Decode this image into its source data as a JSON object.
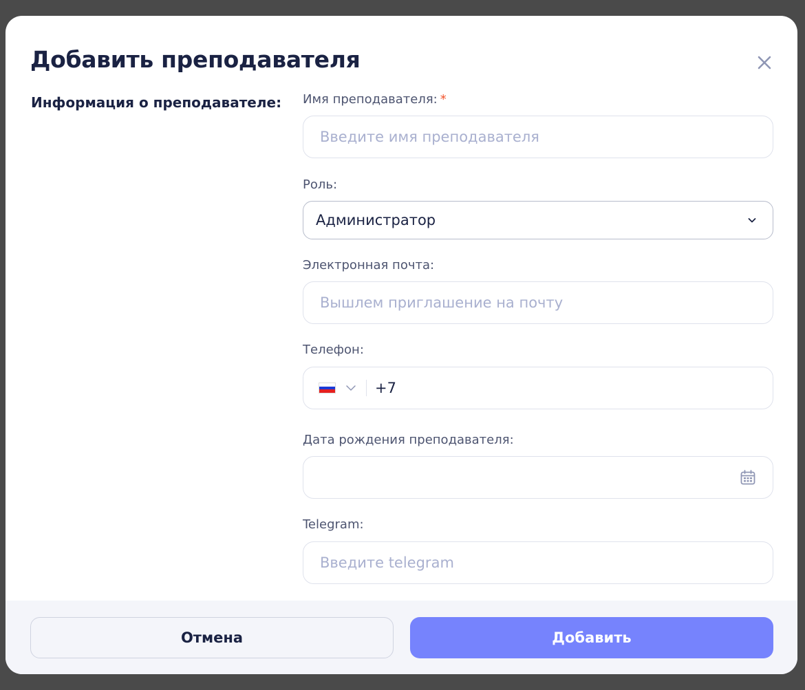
{
  "modal": {
    "title": "Добавить преподавателя",
    "section_label": "Информация о преподавателе:"
  },
  "fields": {
    "name": {
      "label": "Имя преподавателя:",
      "required_mark": "*",
      "placeholder": "Введите имя преподавателя",
      "value": ""
    },
    "role": {
      "label": "Роль:",
      "selected": "Администратор"
    },
    "email": {
      "label": "Электронная почта:",
      "placeholder": "Вышлем приглашение на почту",
      "value": ""
    },
    "phone": {
      "label": "Телефон:",
      "country_icon": "russia-flag-icon",
      "value": "+7"
    },
    "birthdate": {
      "label": "Дата рождения преподавателя:",
      "icon": "calendar-icon",
      "value": ""
    },
    "telegram": {
      "label": "Telegram:",
      "placeholder": "Введите telegram",
      "value": ""
    }
  },
  "footer": {
    "cancel_label": "Отмена",
    "submit_label": "Добавить"
  },
  "colors": {
    "accent": "#7683fd",
    "title": "#1a2243",
    "required": "#f2542d",
    "placeholder": "#a9b0cf"
  }
}
